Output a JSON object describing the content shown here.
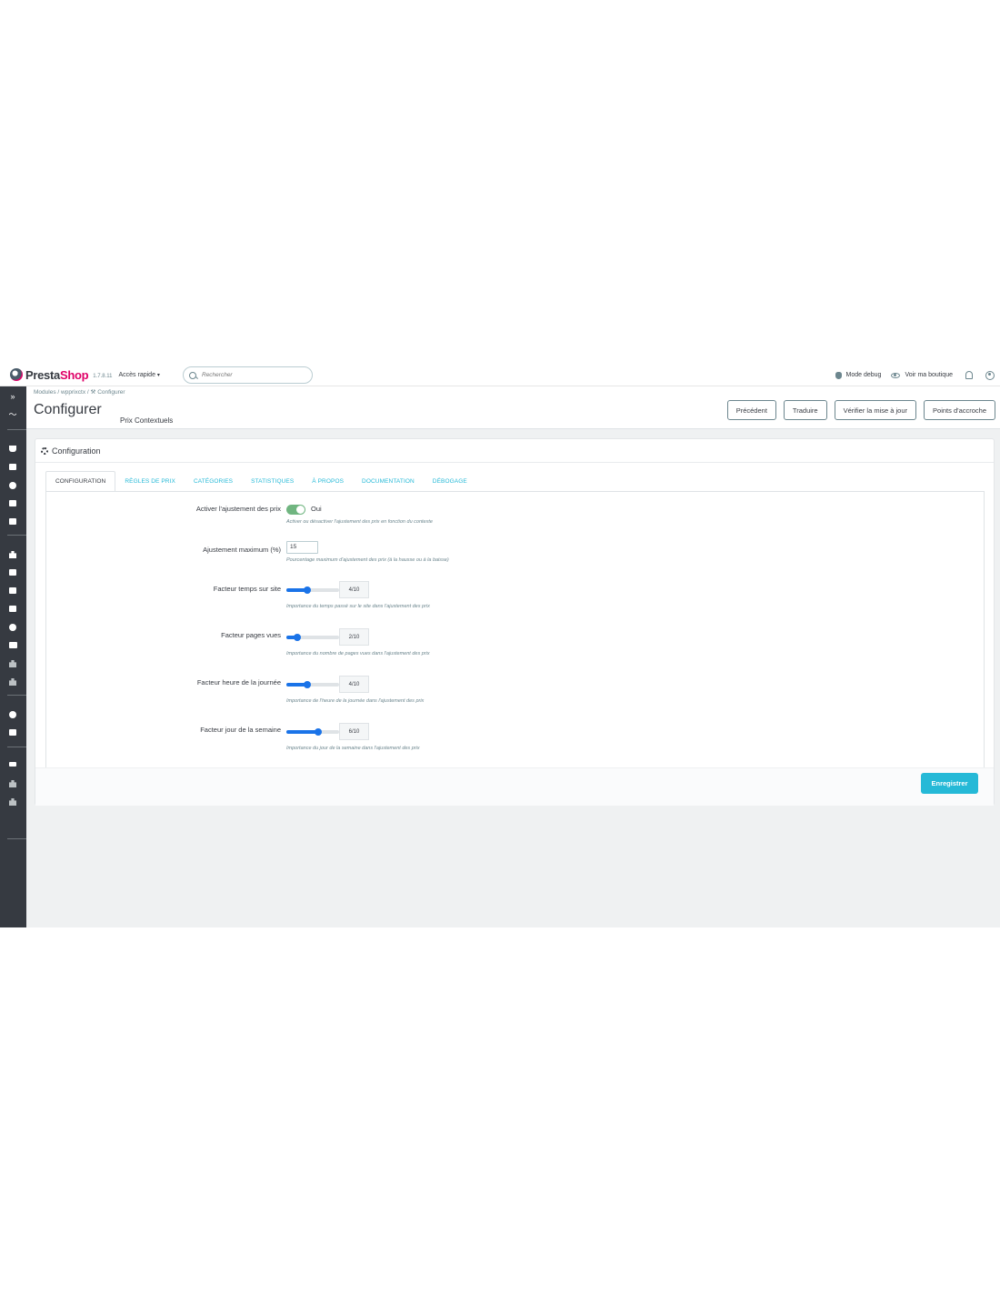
{
  "header": {
    "brand_presta": "Presta",
    "brand_shop": "Shop",
    "version": "1.7.8.11",
    "quick_access": "Accès rapide",
    "search_placeholder": "Rechercher",
    "debug_mode": "Mode debug",
    "view_shop": "Voir ma boutique"
  },
  "breadcrumb": {
    "part1": "Modules",
    "sep1": "/",
    "part2": "wpprixctx",
    "sep2": "/",
    "part3": "Configurer"
  },
  "page": {
    "title": "Configurer",
    "subtitle": "Prix Contextuels"
  },
  "toolbar": {
    "back": "Précédent",
    "translate": "Traduire",
    "check_update": "Vérifier la mise à jour",
    "hooks": "Points d'accroche"
  },
  "panel": {
    "heading": "Configuration",
    "tabs": [
      {
        "label": "CONFIGURATION",
        "active": true
      },
      {
        "label": "RÈGLES DE PRIX",
        "active": false
      },
      {
        "label": "CATÉGORIES",
        "active": false
      },
      {
        "label": "STATISTIQUES",
        "active": false
      },
      {
        "label": "À PROPOS",
        "active": false
      },
      {
        "label": "DOCUMENTATION",
        "active": false
      },
      {
        "label": "DÉBOGAGE",
        "active": false
      }
    ]
  },
  "form": {
    "enable": {
      "label": "Activer l'ajustement des prix",
      "value": "Oui",
      "on": true,
      "help": "Activer ou désactiver l'ajustement des prix en fonction du contexte"
    },
    "max_adjust": {
      "label": "Ajustement maximum (%)",
      "value": "15",
      "help": "Pourcentage maximum d'ajustement des prix (à la hausse ou à la baisse)"
    },
    "time_factor": {
      "label": "Facteur temps sur site",
      "value": 4,
      "max": 10,
      "display": "4/10",
      "help": "Importance du temps passé sur le site dans l'ajustement des prix"
    },
    "pages_factor": {
      "label": "Facteur pages vues",
      "value": 2,
      "max": 10,
      "display": "2/10",
      "help": "Importance du nombre de pages vues dans l'ajustement des prix"
    },
    "hour_factor": {
      "label": "Facteur heure de la journée",
      "value": 4,
      "max": 10,
      "display": "4/10",
      "help": "Importance de l'heure de la journée dans l'ajustement des prix"
    },
    "day_factor": {
      "label": "Facteur jour de la semaine",
      "value": 6,
      "max": 10,
      "display": "6/10",
      "help": "Importance du jour de la semaine dans l'ajustement des prix"
    }
  },
  "footer": {
    "save": "Enregistrer"
  },
  "colors": {
    "accent": "#25b9d7",
    "slider": "#1a73e8",
    "toggle_on": "#70b580",
    "sidebar": "#363a41",
    "brand_pink": "#df0067"
  }
}
